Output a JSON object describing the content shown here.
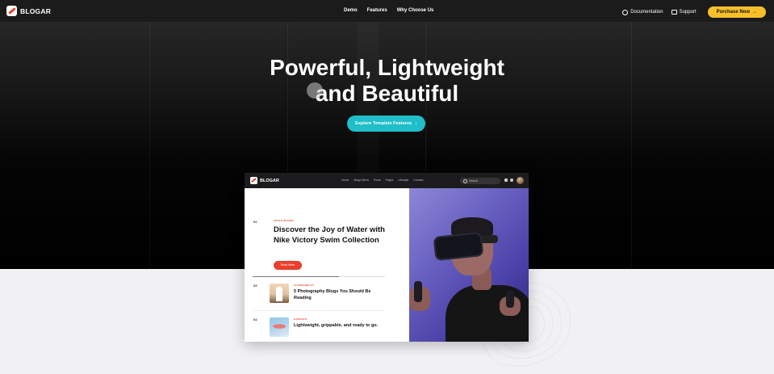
{
  "brand": {
    "name": "BLOGAR"
  },
  "nav": {
    "center_links": [
      "Demo",
      "Features",
      "Why Choose Us"
    ],
    "documentation": "Documentation",
    "support": "Support",
    "purchase": "Purchase Now",
    "purchase_arrow": "→"
  },
  "hero": {
    "line1": "Powerful, Lightweight",
    "line2": "and Beautiful",
    "cta": "Explore Template Features",
    "cta_arrow": "↓"
  },
  "preview": {
    "brand": "BLOGAR",
    "links": [
      "Home",
      "Mega Menu",
      "Posts",
      "Pages",
      "Lifestyle",
      "Contact"
    ],
    "search_placeholder": "Search",
    "featured": {
      "number": "02",
      "category": "APPLE DESIGN",
      "title": "Discover the Joy of Water with Nike Victory Swim Collection",
      "button": "Read More",
      "progress": 0.65
    },
    "list": [
      {
        "number": "03",
        "category": "ACCESSIBILITY",
        "title": "5 Photography Blogs You Should Be Reading"
      },
      {
        "number": "04",
        "category": "GADGETS",
        "title": "Lightweight, grippable, and ready to go."
      }
    ]
  },
  "colors": {
    "accent_yellow": "#f7c02a",
    "accent_cyan": "#1fbec9",
    "accent_red": "#e8402d",
    "hero_dark": "#000000",
    "page_bg": "#f1f1f4"
  }
}
